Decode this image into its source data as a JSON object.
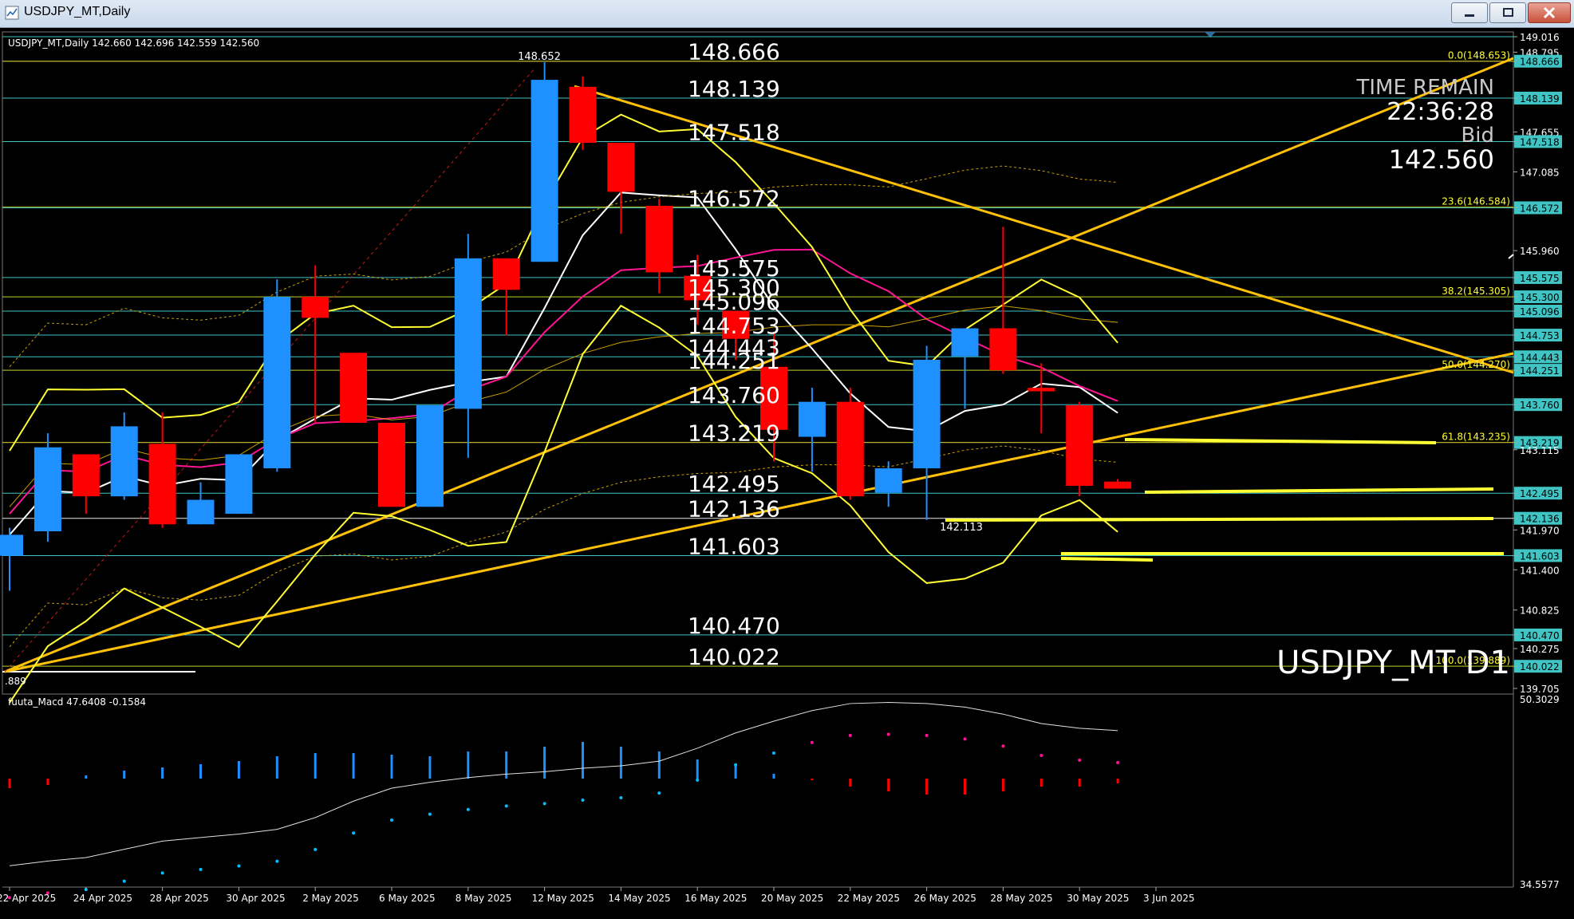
{
  "window": {
    "title": "USDJPY_MT,Daily"
  },
  "info": {
    "header": "USDJPY_MT,Daily  142.660 142.696 142.559 142.560",
    "time_remain_label": "TIME REMAIN",
    "time_remain_value": "22:36:28",
    "bid_label": "Bid",
    "bid_value": "142.560",
    "symbol_watermark": "USDJPY_MT D1",
    "macd_label": "fuuta_Macd 47.6408  -0.1584",
    "left_edge_value": ".889",
    "high_label": "148.652",
    "low_label": "142.113"
  },
  "colors": {
    "bull": "#1e90ff",
    "bear": "#ff0000",
    "trendline": "#ffc107",
    "yellow_band": "#ffff33",
    "teal_level": "#40c4c4",
    "magenta_ma": "#ff1493",
    "white_ma": "#ffffff"
  },
  "chart_data": {
    "type": "candlestick",
    "symbol": "USDJPY_MT",
    "timeframe": "Daily",
    "ylim": [
      139.705,
      149.016
    ],
    "candles": [
      {
        "o": 141.6,
        "h": 142.0,
        "l": 141.1,
        "c": 141.9
      },
      {
        "o": 141.95,
        "h": 143.35,
        "l": 141.8,
        "c": 143.15
      },
      {
        "o": 143.05,
        "h": 143.05,
        "l": 142.2,
        "c": 142.45
      },
      {
        "o": 142.45,
        "h": 143.65,
        "l": 142.4,
        "c": 143.45
      },
      {
        "o": 143.2,
        "h": 143.65,
        "l": 142.0,
        "c": 142.05
      },
      {
        "o": 142.05,
        "h": 142.65,
        "l": 142.05,
        "c": 142.4
      },
      {
        "o": 142.2,
        "h": 143.05,
        "l": 142.2,
        "c": 143.05
      },
      {
        "o": 142.85,
        "h": 145.55,
        "l": 142.8,
        "c": 145.3
      },
      {
        "o": 145.3,
        "h": 145.75,
        "l": 143.5,
        "c": 145.0
      },
      {
        "o": 144.5,
        "h": 144.5,
        "l": 143.5,
        "c": 143.5
      },
      {
        "o": 143.5,
        "h": 143.5,
        "l": 142.3,
        "c": 142.3
      },
      {
        "o": 142.3,
        "h": 143.75,
        "l": 142.3,
        "c": 143.75
      },
      {
        "o": 143.7,
        "h": 146.2,
        "l": 143.0,
        "c": 145.85
      },
      {
        "o": 145.85,
        "h": 145.85,
        "l": 144.75,
        "c": 145.4
      },
      {
        "o": 145.8,
        "h": 148.652,
        "l": 145.8,
        "c": 148.4
      },
      {
        "o": 148.3,
        "h": 148.45,
        "l": 147.4,
        "c": 147.5
      },
      {
        "o": 147.5,
        "h": 147.5,
        "l": 146.2,
        "c": 146.8
      },
      {
        "o": 146.6,
        "h": 146.7,
        "l": 145.35,
        "c": 145.65
      },
      {
        "o": 145.6,
        "h": 145.9,
        "l": 144.9,
        "c": 145.25
      },
      {
        "o": 145.1,
        "h": 145.1,
        "l": 144.4,
        "c": 144.7
      },
      {
        "o": 144.3,
        "h": 144.8,
        "l": 142.95,
        "c": 143.4
      },
      {
        "o": 143.3,
        "h": 144.0,
        "l": 142.8,
        "c": 143.8
      },
      {
        "o": 143.8,
        "h": 144.0,
        "l": 142.4,
        "c": 142.45
      },
      {
        "o": 142.5,
        "h": 142.95,
        "l": 142.3,
        "c": 142.85
      },
      {
        "o": 142.85,
        "h": 144.6,
        "l": 142.113,
        "c": 144.4
      },
      {
        "o": 144.45,
        "h": 144.85,
        "l": 143.7,
        "c": 144.85
      },
      {
        "o": 144.85,
        "h": 146.3,
        "l": 144.2,
        "c": 144.25
      },
      {
        "o": 144.0,
        "h": 144.35,
        "l": 143.35,
        "c": 143.95
      },
      {
        "o": 143.75,
        "h": 143.8,
        "l": 142.45,
        "c": 142.6
      },
      {
        "o": 142.66,
        "h": 142.696,
        "l": 142.559,
        "c": 142.56
      }
    ],
    "price_levels": [
      149.016,
      148.666,
      148.139,
      147.518,
      146.572,
      145.575,
      145.3,
      145.096,
      144.753,
      144.443,
      144.251,
      143.76,
      143.219,
      142.495,
      142.136,
      141.603,
      140.47,
      140.022
    ],
    "on_chart_level_labels": [
      "148.666",
      "148.139",
      "147.518",
      "146.572",
      "145.575",
      "145.300",
      "145.096",
      "144.753",
      "144.443",
      "144.251",
      "143.760",
      "143.219",
      "142.495",
      "142.136",
      "141.603",
      "140.470",
      "140.022"
    ],
    "axis_ticks": [
      {
        "label": "149.016",
        "v": 149.016,
        "highlight": false
      },
      {
        "label": "148.795",
        "v": 148.795,
        "highlight": false
      },
      {
        "label": "148.666",
        "v": 148.666,
        "highlight": true
      },
      {
        "label": "148.139",
        "v": 148.139,
        "highlight": true
      },
      {
        "label": "147.655",
        "v": 147.655,
        "highlight": false
      },
      {
        "label": "147.518",
        "v": 147.518,
        "highlight": true
      },
      {
        "label": "147.085",
        "v": 147.085,
        "highlight": false
      },
      {
        "label": "146.572",
        "v": 146.572,
        "highlight": true
      },
      {
        "label": "145.960",
        "v": 145.96,
        "highlight": false
      },
      {
        "label": "145.575",
        "v": 145.575,
        "highlight": true
      },
      {
        "label": "145.300",
        "v": 145.3,
        "highlight": true
      },
      {
        "label": "145.096",
        "v": 145.096,
        "highlight": true
      },
      {
        "label": "144.753",
        "v": 144.753,
        "highlight": true
      },
      {
        "label": "144.443",
        "v": 144.443,
        "highlight": true
      },
      {
        "label": "144.251",
        "v": 144.251,
        "highlight": true
      },
      {
        "label": "143.760",
        "v": 143.76,
        "highlight": true
      },
      {
        "label": "143.219",
        "v": 143.219,
        "highlight": true
      },
      {
        "label": "143.115",
        "v": 143.115,
        "highlight": false
      },
      {
        "label": "142.495",
        "v": 142.495,
        "highlight": true
      },
      {
        "label": "142.136",
        "v": 142.136,
        "highlight": true
      },
      {
        "label": "141.970",
        "v": 141.97,
        "highlight": false
      },
      {
        "label": "141.603",
        "v": 141.603,
        "highlight": true
      },
      {
        "label": "141.400",
        "v": 141.4,
        "highlight": false
      },
      {
        "label": "140.825",
        "v": 140.825,
        "highlight": false
      },
      {
        "label": "140.470",
        "v": 140.47,
        "highlight": true
      },
      {
        "label": "140.275",
        "v": 140.275,
        "highlight": false
      },
      {
        "label": "140.022",
        "v": 140.022,
        "highlight": true
      },
      {
        "label": "139.705",
        "v": 139.705,
        "highlight": false
      }
    ],
    "fib_labels": [
      {
        "label": "0.0(148.653)",
        "v": 148.666
      },
      {
        "label": "23.6(146.584)",
        "v": 146.584
      },
      {
        "label": "38.2(145.305)",
        "v": 145.3
      },
      {
        "label": "50.0(144.270)",
        "v": 144.251
      },
      {
        "label": "61.8(143.235)",
        "v": 143.219
      },
      {
        "label": "100.0(139.889)",
        "v": 140.022
      }
    ],
    "x_labels": [
      "22 Apr 2025",
      "24 Apr 2025",
      "28 Apr 2025",
      "30 Apr 2025",
      "2 May 2025",
      "6 May 2025",
      "8 May 2025",
      "12 May 2025",
      "14 May 2025",
      "16 May 2025",
      "20 May 2025",
      "22 May 2025",
      "26 May 2025",
      "28 May 2025",
      "30 May 2025",
      "3 Jun 2025"
    ],
    "macd": {
      "ylim": [
        34.5577,
        50.3029
      ],
      "axis_labels": [
        "50.3029",
        "34.5577"
      ],
      "histogram": [
        -0.6,
        -0.4,
        0.2,
        0.5,
        0.7,
        0.9,
        1.1,
        1.4,
        1.6,
        1.6,
        1.5,
        1.4,
        1.7,
        1.7,
        2.0,
        2.3,
        2.0,
        1.7,
        1.2,
        0.8,
        0.3,
        -0.1,
        -0.5,
        -0.8,
        -1.0,
        -1.0,
        -0.8,
        -0.5,
        -0.5,
        -0.3
      ],
      "signal": [
        36.1,
        36.5,
        36.8,
        37.5,
        38.2,
        38.5,
        38.8,
        39.2,
        40.2,
        41.6,
        42.7,
        43.2,
        43.6,
        43.9,
        44.1,
        44.4,
        44.6,
        45.0,
        46.1,
        47.4,
        48.4,
        49.3,
        49.9,
        50.0,
        49.9,
        49.6,
        49.0,
        48.2,
        47.8,
        47.6
      ]
    }
  }
}
